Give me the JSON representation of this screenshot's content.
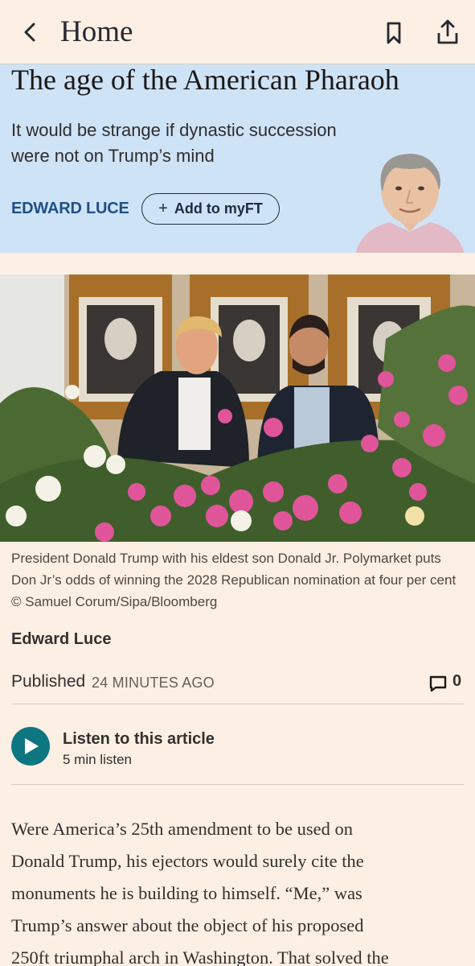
{
  "topbar": {
    "title": "Home",
    "back_icon": "chevron-left-icon",
    "bookmark_icon": "bookmark-icon",
    "share_icon": "share-icon"
  },
  "header": {
    "headline": "The age of the American Pharaoh",
    "standfirst": "It would be strange if dynastic succession were not on Trump’s mind",
    "author_tag": "EDWARD LUCE",
    "add_button": "Add to myFT",
    "background_color": "#cfe3f7"
  },
  "photo": {
    "caption": "President Donald Trump with his eldest son Donald Jr. Polymarket puts Don Jr’s odds of winning the 2028 Republican nomination at four per cent © Samuel Corum/Sipa/Bloomberg"
  },
  "article": {
    "byline": "Edward Luce",
    "published_label": "Published",
    "published_time": "24 minutes ago",
    "comment_count": "0",
    "listen_title": "Listen to this article",
    "listen_duration": "5 min listen",
    "body_lines": [
      "Were America’s 25th amendment to be used on",
      "Donald Trump, his ejectors would surely cite the",
      "monuments he is building to himself. “Me,” was",
      "Trump’s answer about the object of his proposed",
      "250ft triumphal arch in Washington. That solved the"
    ]
  },
  "colors": {
    "page_bg": "#fcefe3",
    "accent_teal": "#0d7680",
    "author_blue": "#1f4f86"
  }
}
